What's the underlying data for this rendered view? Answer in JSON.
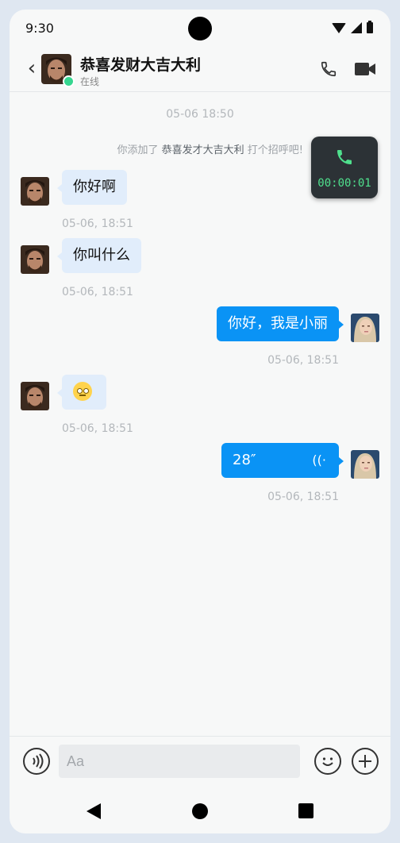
{
  "status_bar": {
    "time": "9:30",
    "icons": [
      "wifi-icon",
      "signal-icon",
      "battery-icon"
    ]
  },
  "header": {
    "back_icon": "back-chevron-icon",
    "contact_name": "恭喜发财大吉大利",
    "status": "在线",
    "actions": [
      "phone-icon",
      "video-camera-icon"
    ]
  },
  "chat": {
    "date_separator": "05-06 18:50",
    "system_note": {
      "prefix": "你添加了",
      "name": "恭喜发才大吉大利",
      "suffix": "打个招呼吧!"
    },
    "call_overlay": {
      "timer": "00:00:01"
    },
    "messages": [
      {
        "side": "incoming",
        "type": "text",
        "text": "你好啊",
        "time": "05-06, 18:51"
      },
      {
        "side": "incoming",
        "type": "text",
        "text": "你叫什么",
        "time": "05-06, 18:51"
      },
      {
        "side": "outgoing",
        "type": "text",
        "text": "你好，我是小丽",
        "time": "05-06, 18:51"
      },
      {
        "side": "incoming",
        "type": "emoji",
        "emoji": "face-with-rolling-eyes",
        "time": "05-06, 18:51"
      },
      {
        "side": "outgoing",
        "type": "voice",
        "duration": "28″",
        "time": "05-06, 18:51"
      }
    ]
  },
  "input_bar": {
    "placeholder": "Aa",
    "value": ""
  },
  "colors": {
    "outgoing_bubble": "#0a93f5",
    "incoming_bubble": "#e1edfb",
    "online": "#36d690",
    "call_timer": "#4fe08d"
  }
}
